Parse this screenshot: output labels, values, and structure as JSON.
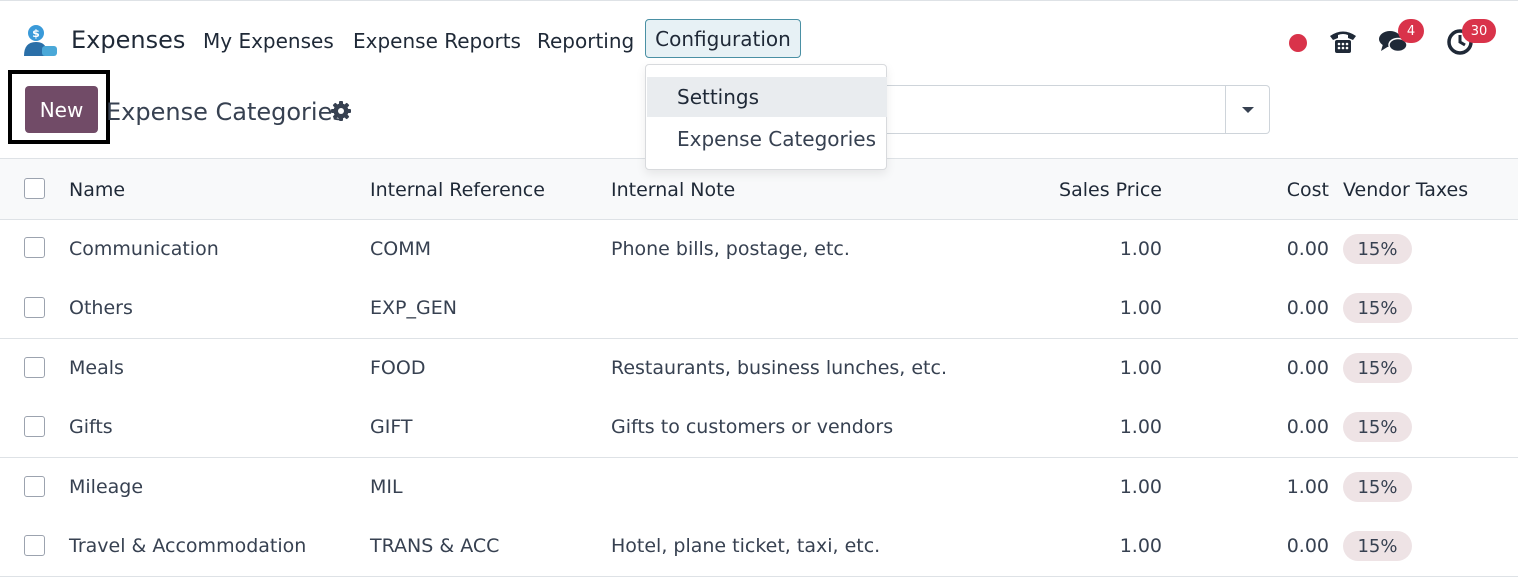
{
  "navbar": {
    "app_name": "Expenses",
    "menu": [
      "My Expenses",
      "Expense Reports",
      "Reporting"
    ],
    "active_menu": "Configuration",
    "messages_count": "4",
    "activities_count": "30"
  },
  "control_panel": {
    "new_label": "New",
    "breadcrumb": "Expense Categories"
  },
  "dropdown": {
    "items": [
      "Settings",
      "Expense Categories"
    ]
  },
  "table": {
    "columns": {
      "name": "Name",
      "internal_reference": "Internal Reference",
      "internal_note": "Internal Note",
      "sales_price": "Sales Price",
      "cost": "Cost",
      "vendor_taxes": "Vendor Taxes"
    },
    "rows": [
      {
        "name": "Communication",
        "ref": "COMM",
        "note": "Phone bills, postage, etc.",
        "price": "1.00",
        "cost": "0.00",
        "tax": "15%"
      },
      {
        "name": "Others",
        "ref": "EXP_GEN",
        "note": "",
        "price": "1.00",
        "cost": "0.00",
        "tax": "15%"
      },
      {
        "name": "Meals",
        "ref": "FOOD",
        "note": "Restaurants, business lunches, etc.",
        "price": "1.00",
        "cost": "0.00",
        "tax": "15%"
      },
      {
        "name": "Gifts",
        "ref": "GIFT",
        "note": "Gifts to customers or vendors",
        "price": "1.00",
        "cost": "0.00",
        "tax": "15%"
      },
      {
        "name": "Mileage",
        "ref": "MIL",
        "note": "",
        "price": "1.00",
        "cost": "1.00",
        "tax": "15%"
      },
      {
        "name": "Travel & Accommodation",
        "ref": "TRANS & ACC",
        "note": "Hotel, plane ticket, taxi, etc.",
        "price": "1.00",
        "cost": "0.00",
        "tax": "15%"
      }
    ]
  },
  "colors": {
    "primary": "#714b67",
    "badge": "#d9334a",
    "tag_bg": "#eee3e5",
    "logo_blue": "#3a9ad9"
  },
  "icons": [
    "app-logo-icon",
    "status-dot-icon",
    "phone-icon",
    "chat-icon",
    "clock-icon",
    "gear-icon",
    "caret-down-icon"
  ]
}
